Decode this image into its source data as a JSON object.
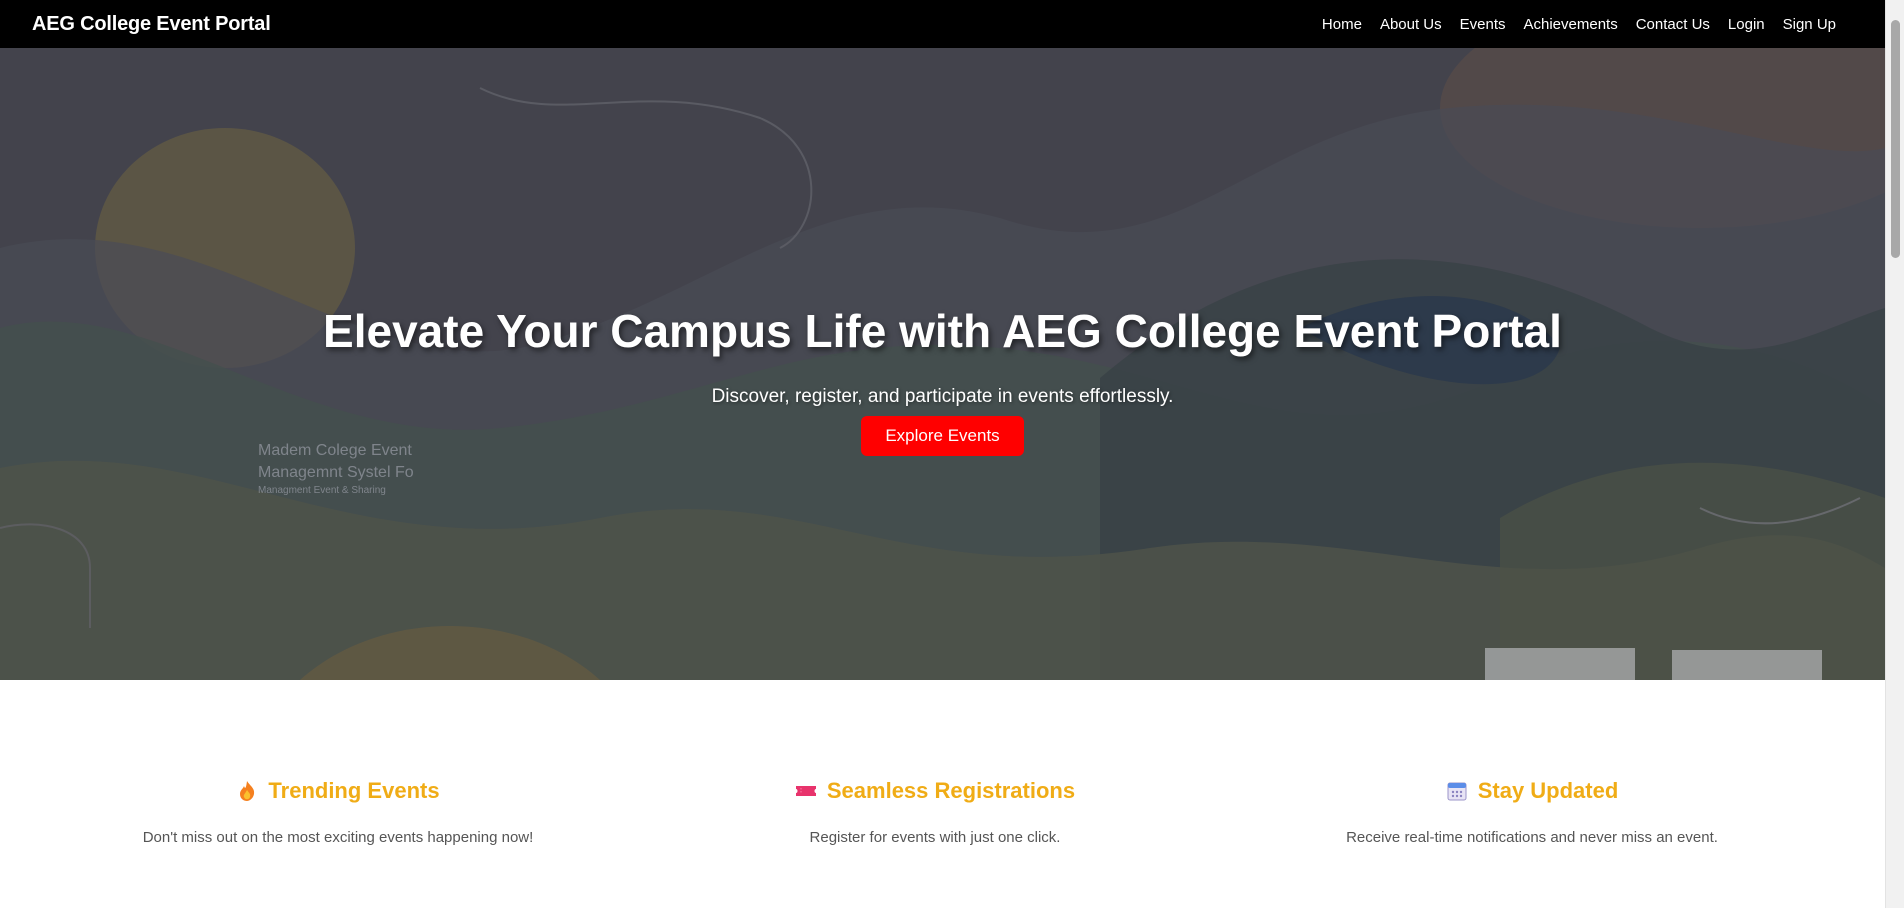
{
  "navbar": {
    "brand": "AEG College Event Portal",
    "links": [
      "Home",
      "About Us",
      "Events",
      "Achievements",
      "Contact Us",
      "Login",
      "Sign Up"
    ]
  },
  "hero": {
    "title": "Elevate Your Campus Life with AEG College Event Portal",
    "subtitle": "Discover, register, and participate in events effortlessly.",
    "button_label": "Explore Events",
    "button_color": "#ff0000"
  },
  "features": [
    {
      "icon": "fire-icon",
      "title": "Trending Events",
      "description": "Don't miss out on the most exciting events happening now!"
    },
    {
      "icon": "ticket-icon",
      "title": "Seamless Registrations",
      "description": "Register for events with just one click."
    },
    {
      "icon": "calendar-icon",
      "title": "Stay Updated",
      "description": "Receive real-time notifications and never miss an event."
    }
  ],
  "colors": {
    "navbar_bg": "#000000",
    "feature_title": "#f0ac16",
    "feature_text": "#555555"
  }
}
